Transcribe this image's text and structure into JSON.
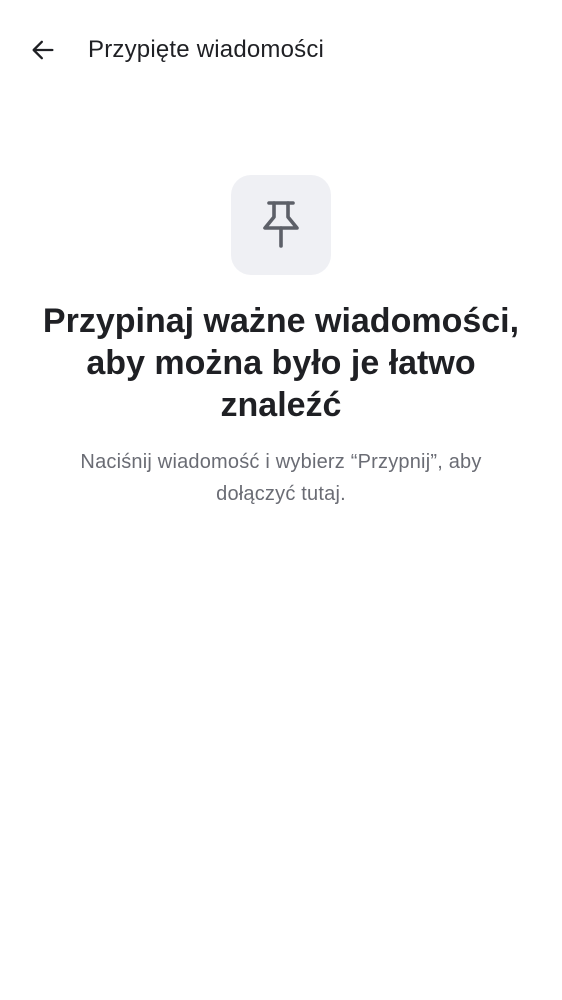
{
  "header": {
    "back_icon": "arrow-left-icon",
    "title": "Przypięte wiadomości"
  },
  "empty_state": {
    "icon": "pin-icon",
    "colors": {
      "icon_tile_background": "#eff0f4",
      "icon_stroke": "#5d6068",
      "headline": "#1f2024",
      "subtext": "#6a6c74"
    },
    "headline": "Przypinaj ważne wiadomości, aby można było je łatwo znaleźć",
    "description": "Naciśnij wiadomość i wybierz “Przypnij”, aby dołączyć tutaj."
  }
}
